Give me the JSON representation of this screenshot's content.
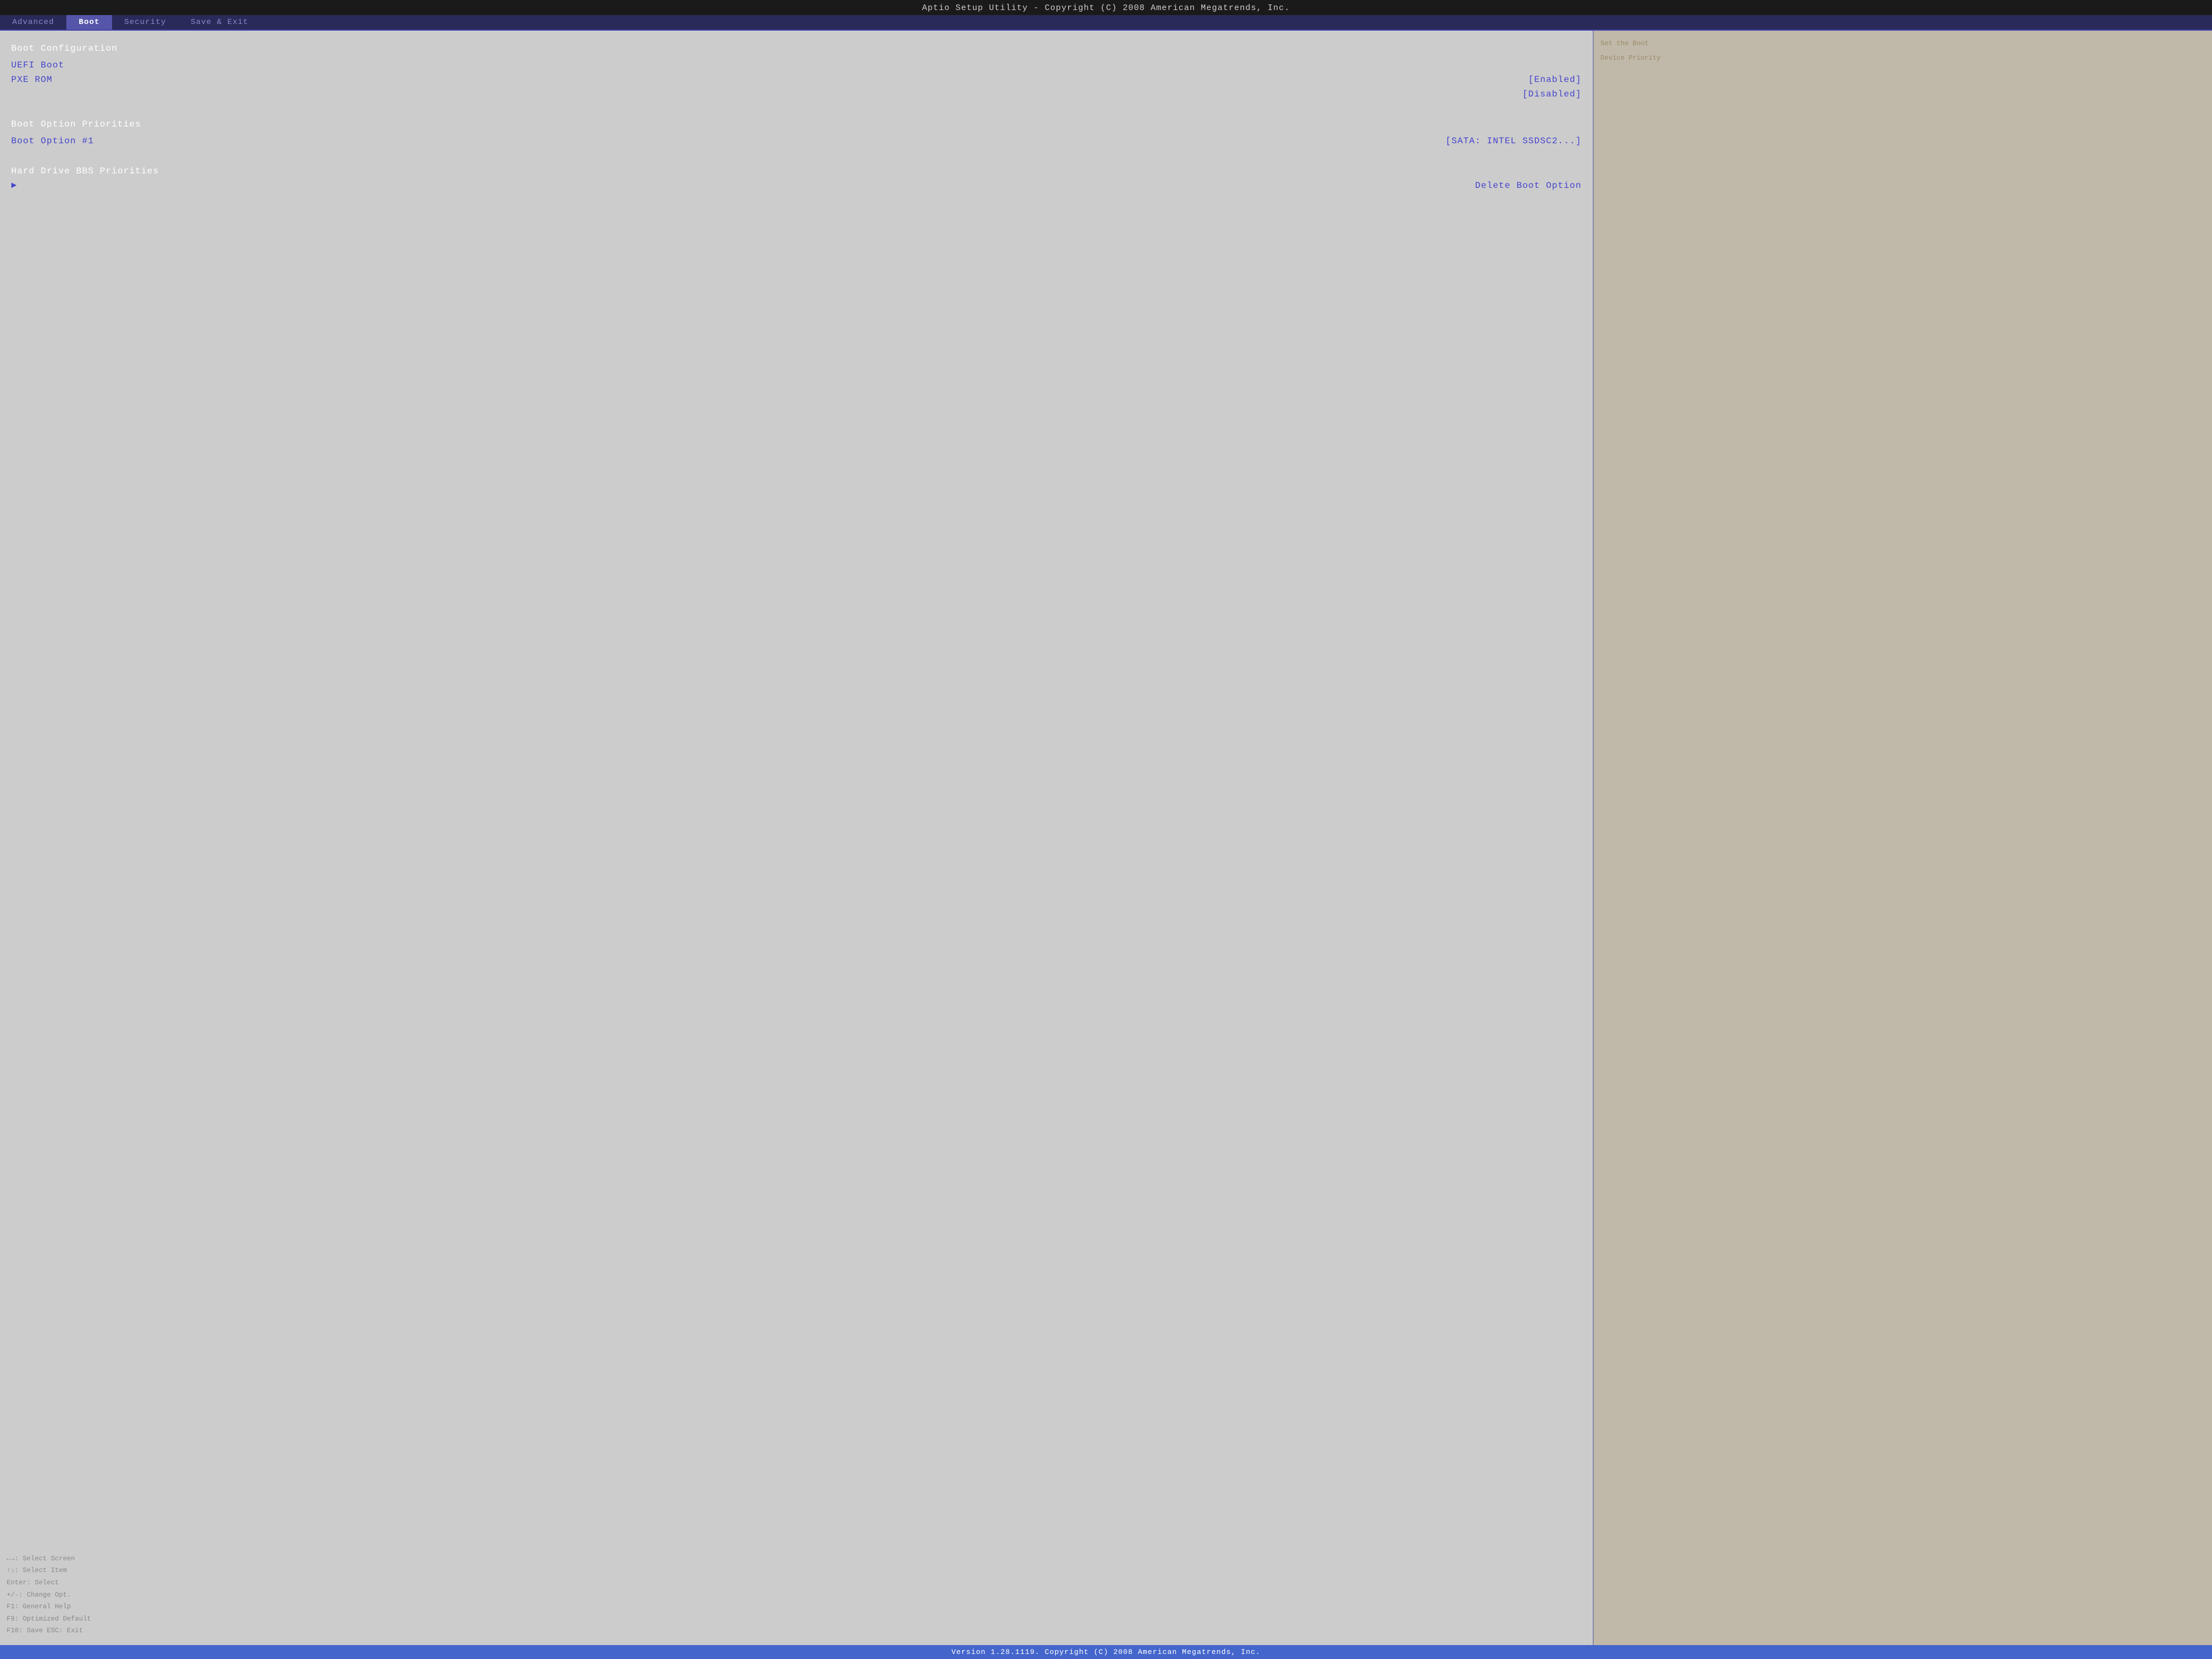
{
  "title_bar": {
    "text": "Aptio Setup Utility - Copyright (C) 2008 American Megatrends, Inc."
  },
  "nav": {
    "tabs": [
      {
        "label": "Advanced",
        "active": false
      },
      {
        "label": "Boot",
        "active": true
      },
      {
        "label": "Security",
        "active": false
      },
      {
        "label": "Save & Exit",
        "active": false
      }
    ]
  },
  "main": {
    "boot_config_header": "Boot Configuration",
    "uefi_boot_label": "UEFI Boot",
    "pxe_rom_label": "PXE ROM",
    "pxe_rom_value": "[Enabled]",
    "uefi_boot_value": "[Disabled]",
    "boot_option_priorities_header": "Boot Option Priorities",
    "boot_option_1_label": "Boot Option #1",
    "boot_option_1_value": "[SATA: INTEL SSDSC2...]",
    "hard_drive_bbs_label": "Hard Drive BBS Priorities",
    "delete_boot_option_label": "Delete Boot Option"
  },
  "right_panel": {
    "help_line1": "Set the Boot",
    "help_line2": "Device Priority",
    "key_help": {
      "select_screen": "←→: Select Screen",
      "select_item": "↑↓: Select Item",
      "enter_select": "Enter: Select",
      "change_opt": "+/-: Change Opt.",
      "general_help": "F1: General Help",
      "optimized_default": "F9: Optimized Default",
      "save_exit": "F10: Save  ESC: Exit"
    }
  },
  "status_bar": {
    "text": "Version 1.28.1119. Copyright (C) 2008 American Megatrends, Inc."
  }
}
